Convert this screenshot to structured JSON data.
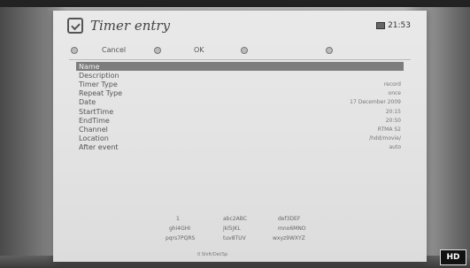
{
  "window": {
    "title": "Timer entry",
    "time": "21:53"
  },
  "buttons": [
    {
      "label": "Cancel"
    },
    {
      "label": ""
    },
    {
      "label": "OK"
    },
    {
      "label": ""
    },
    {
      "label": ""
    }
  ],
  "fields": [
    {
      "label": "Name",
      "value": ""
    },
    {
      "label": "Description",
      "value": ""
    },
    {
      "label": "Timer Type",
      "value": "record"
    },
    {
      "label": "Repeat Type",
      "value": "once"
    },
    {
      "label": "Date",
      "value": "17 December 2009"
    },
    {
      "label": "StartTime",
      "value": "20:15"
    },
    {
      "label": "EndTime",
      "value": "20:50"
    },
    {
      "label": "Channel",
      "value": "RTMA S2"
    },
    {
      "label": "Location",
      "value": "/hdd/movie/"
    },
    {
      "label": "After event",
      "value": "auto"
    }
  ],
  "keyboard": {
    "rows": [
      [
        "1",
        "abc2ABC",
        "def3DEF"
      ],
      [
        "ghi4GHI",
        "jkl5JKL",
        "mno6MNO"
      ],
      [
        "pqrs7PQRS",
        "tuv8TUV",
        "wxyz9WXYZ"
      ]
    ],
    "footer": "0 Shift/Del/Sp"
  },
  "overlay": {
    "badge": "HD"
  },
  "colors": {
    "panel_bg": "#e4e4e4",
    "selection": "#7c7c7c",
    "text": "#555555"
  }
}
